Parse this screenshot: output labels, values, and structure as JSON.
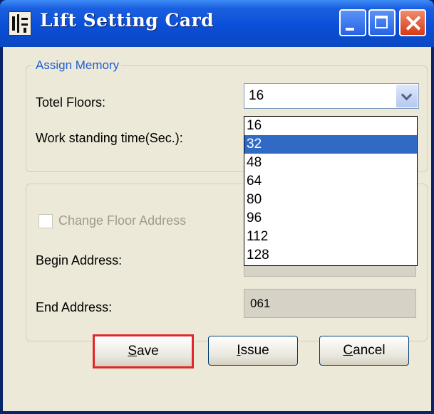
{
  "window": {
    "title": "Lift Setting Card"
  },
  "assign_memory": {
    "legend": "Assign Memory",
    "total_floors_label": "Totel Floors:",
    "total_floors_value": "16",
    "work_time_label": "Work standing time(Sec.):",
    "dropdown_options": [
      "16",
      "32",
      "48",
      "64",
      "80",
      "96",
      "112",
      "128"
    ],
    "dropdown_highlighted": "32"
  },
  "address": {
    "checkbox_label": "Change Floor Address",
    "begin_label": "Begin Address:",
    "begin_value": "",
    "end_label": "End Address:",
    "end_value": "061"
  },
  "buttons": {
    "save_mnemonic": "S",
    "save_rest": "ave",
    "issue_mnemonic": "I",
    "issue_rest": "ssue",
    "cancel_mnemonic": "C",
    "cancel_rest": "ancel"
  },
  "colors": {
    "title_bar": "#0a4fd8",
    "highlight": "#316ac5",
    "save_focus_border": "#e4262a"
  }
}
